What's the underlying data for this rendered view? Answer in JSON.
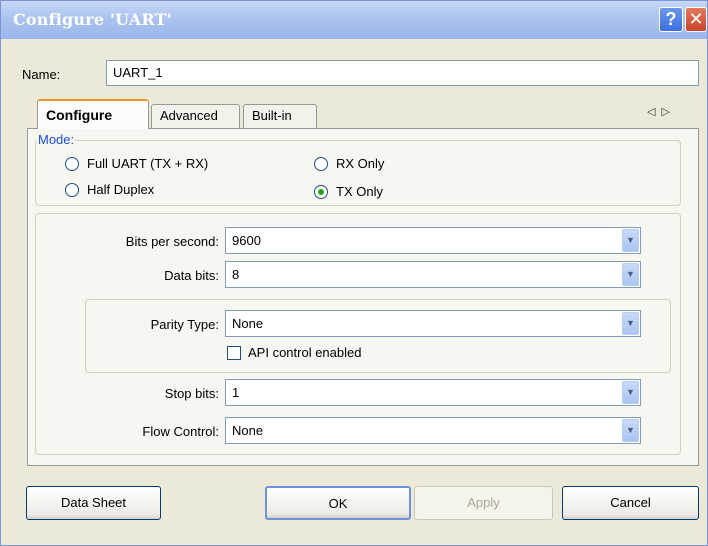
{
  "window": {
    "title": "Configure 'UART'"
  },
  "titlebar": {
    "help_glyph": "?",
    "close_glyph": "✕",
    "help_icon": "question-icon",
    "close_icon": "close-icon"
  },
  "name_field": {
    "label": "Name:",
    "value": "UART_1"
  },
  "tabs": [
    {
      "label": "Configure",
      "active": true
    },
    {
      "label": "Advanced",
      "active": false
    },
    {
      "label": "Built-in",
      "active": false
    }
  ],
  "tab_scroll": {
    "glyphs": "◁▷"
  },
  "mode": {
    "legend": "Mode:",
    "options": [
      {
        "label": "Full UART (TX + RX)",
        "selected": false
      },
      {
        "label": "Half Duplex",
        "selected": false
      },
      {
        "label": "RX Only",
        "selected": false
      },
      {
        "label": "TX Only",
        "selected": true
      }
    ]
  },
  "fields": {
    "bits_per_second": {
      "label": "Bits per second:",
      "value": "9600"
    },
    "data_bits": {
      "label": "Data bits:",
      "value": "8"
    },
    "parity_type": {
      "label": "Parity Type:",
      "value": "None"
    },
    "api_control": {
      "label": "API control enabled",
      "checked": false
    },
    "stop_bits": {
      "label": "Stop bits:",
      "value": "1"
    },
    "flow_control": {
      "label": "Flow Control:",
      "value": "None"
    }
  },
  "combo_glyph": "▼",
  "buttons": {
    "data_sheet": "Data Sheet",
    "ok": "OK",
    "apply": "Apply",
    "cancel": "Cancel"
  },
  "colors": {
    "titlebar": "#a9c2ee",
    "dialog_bg": "#ece9d8",
    "accent_tab": "#e69b25",
    "radio_selected": "#21a121",
    "legend_text": "#1c4fd6"
  }
}
